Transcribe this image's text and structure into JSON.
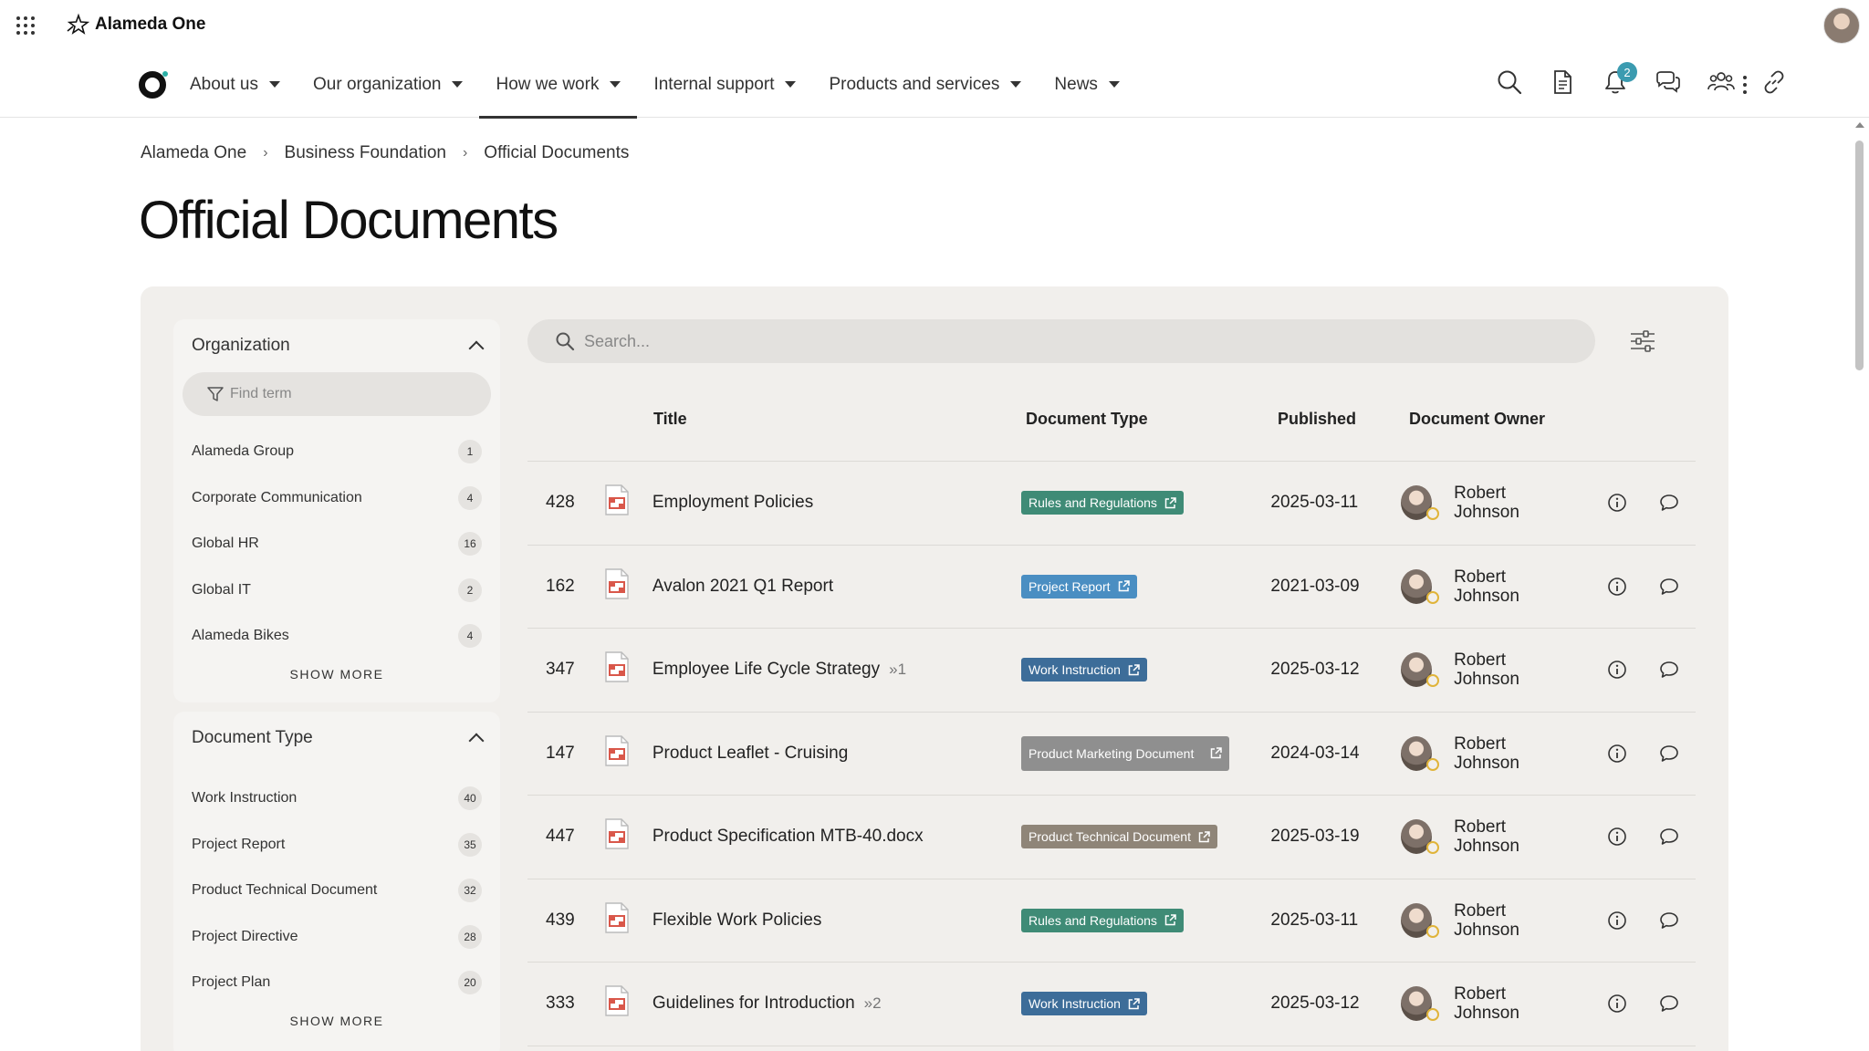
{
  "app": {
    "brand": "Alameda One"
  },
  "nav": {
    "items": [
      {
        "label": "About us"
      },
      {
        "label": "Our organization"
      },
      {
        "label": "How we work"
      },
      {
        "label": "Internal support"
      },
      {
        "label": "Products and services"
      },
      {
        "label": "News"
      }
    ],
    "active_index": 2,
    "icons": [
      "search-icon",
      "document-icon",
      "bell-icon",
      "chat-icon",
      "people-icon",
      "link-icon",
      "more-icon"
    ],
    "notifications_count": "2"
  },
  "breadcrumb": [
    "Alameda One",
    "Business Foundation",
    "Official Documents"
  ],
  "page_title": "Official Documents",
  "facets": {
    "organization": {
      "title": "Organization",
      "find_placeholder": "Find term",
      "items": [
        {
          "label": "Alameda Group",
          "count": "1"
        },
        {
          "label": "Corporate Communication",
          "count": "4"
        },
        {
          "label": "Global HR",
          "count": "16"
        },
        {
          "label": "Global IT",
          "count": "2"
        },
        {
          "label": "Alameda Bikes",
          "count": "4"
        }
      ],
      "show_more": "SHOW MORE"
    },
    "document_type": {
      "title": "Document Type",
      "items": [
        {
          "label": "Work Instruction",
          "count": "40"
        },
        {
          "label": "Project Report",
          "count": "35"
        },
        {
          "label": "Product Technical Document",
          "count": "32"
        },
        {
          "label": "Project Directive",
          "count": "28"
        },
        {
          "label": "Project Plan",
          "count": "20"
        }
      ],
      "show_more": "SHOW MORE"
    }
  },
  "search": {
    "placeholder": "Search..."
  },
  "table": {
    "headers": {
      "title": "Title",
      "type": "Document Type",
      "published": "Published",
      "owner": "Document Owner"
    },
    "type_colors": {
      "Rules and Regulations": "#3f8b76",
      "Project Report": "#4a8ec2",
      "Work Instruction": "#3d6d99",
      "Product Marketing Document": "#8f8f8f",
      "Product Technical Document": "#8f8578"
    },
    "rows": [
      {
        "id": "428",
        "title": "Employment Policies",
        "versions": "",
        "type": "Rules and Regulations",
        "published": "2025-03-11",
        "owner_first": "Robert",
        "owner_last": "Johnson"
      },
      {
        "id": "162",
        "title": "Avalon 2021 Q1 Report",
        "versions": "",
        "type": "Project Report",
        "published": "2021-03-09",
        "owner_first": "Robert",
        "owner_last": "Johnson"
      },
      {
        "id": "347",
        "title": "Employee Life Cycle Strategy",
        "versions": "»1",
        "type": "Work Instruction",
        "published": "2025-03-12",
        "owner_first": "Robert",
        "owner_last": "Johnson"
      },
      {
        "id": "147",
        "title": "Product Leaflet - Cruising",
        "versions": "",
        "type": "Product Marketing Document",
        "published": "2024-03-14",
        "owner_first": "Robert",
        "owner_last": "Johnson"
      },
      {
        "id": "447",
        "title": "Product Specification MTB-40.docx",
        "versions": "",
        "type": "Product Technical Document",
        "published": "2025-03-19",
        "owner_first": "Robert",
        "owner_last": "Johnson"
      },
      {
        "id": "439",
        "title": "Flexible Work Policies",
        "versions": "",
        "type": "Rules and Regulations",
        "published": "2025-03-11",
        "owner_first": "Robert",
        "owner_last": "Johnson"
      },
      {
        "id": "333",
        "title": "Guidelines for Introduction",
        "versions": "»2",
        "type": "Work Instruction",
        "published": "2025-03-12",
        "owner_first": "Robert",
        "owner_last": "Johnson"
      }
    ]
  }
}
